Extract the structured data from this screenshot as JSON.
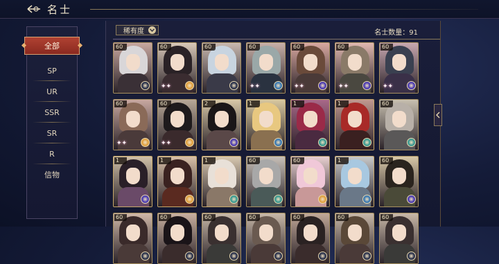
{
  "header": {
    "title": "名士"
  },
  "sidebar": {
    "items": [
      {
        "label": "全部",
        "active": true
      },
      {
        "label": "SP"
      },
      {
        "label": "UR"
      },
      {
        "label": "SSR"
      },
      {
        "label": "SR"
      },
      {
        "label": "R"
      },
      {
        "label": "信物"
      }
    ]
  },
  "toolbar": {
    "filter_label": "稀有度",
    "count_text": "名士数量：91"
  },
  "cards": [
    {
      "level": "60",
      "hair": "#d9d6d8",
      "bg": "#c8a8a0",
      "robe": "#3a3036",
      "badge": "#28304a",
      "sparkle": false
    },
    {
      "level": "60",
      "hair": "#2a2226",
      "bg": "#d8c8b8",
      "robe": "#3a2c30",
      "badge": "#e0a040",
      "sparkle": true
    },
    {
      "level": "60",
      "hair": "#c8d4e0",
      "bg": "#c8b8b0",
      "robe": "#3a3a48",
      "badge": "#28304a",
      "sparkle": false
    },
    {
      "level": "60",
      "hair": "#9aa8a8",
      "bg": "#c8b0a8",
      "robe": "#2a3240",
      "badge": "#3a78b0",
      "sparkle": true
    },
    {
      "level": "60",
      "hair": "#6a4a3a",
      "bg": "#d8a8a0",
      "robe": "#4a3a38",
      "badge": "#4a3ab0",
      "sparkle": true
    },
    {
      "level": "60",
      "hair": "#8a7a68",
      "bg": "#e0b8b0",
      "robe": "#4a4840",
      "badge": "#4a3ab0",
      "sparkle": true
    },
    {
      "level": "60",
      "hair": "#3a4050",
      "bg": "#c8a8b0",
      "robe": "#3a3048",
      "badge": "#4a3ab0",
      "sparkle": true
    },
    {
      "level": "60",
      "hair": "#8a6a58",
      "bg": "#c8a8a0",
      "robe": "#4a3a3a",
      "badge": "#e0a040",
      "sparkle": true
    },
    {
      "level": "60",
      "hair": "#1e1a1c",
      "bg": "#b8a898",
      "robe": "#3a2a2c",
      "badge": "#e0a040",
      "sparkle": true
    },
    {
      "level": "2",
      "hair": "#1a1618",
      "bg": "#d8c8a8",
      "robe": "#5a4848",
      "badge": "#4a3ab0",
      "sparkle": false
    },
    {
      "level": "1",
      "hair": "#e8c880",
      "bg": "#d8c8a0",
      "robe": "#8a7050",
      "badge": "#3a78b0",
      "sparkle": false
    },
    {
      "level": "1",
      "hair": "#9a2a48",
      "bg": "#a86888",
      "robe": "#4a2a40",
      "badge": "#3a9890",
      "sparkle": false
    },
    {
      "level": "1",
      "hair": "#a82a28",
      "bg": "#c09890",
      "robe": "#3a2020",
      "badge": "#3a9890",
      "sparkle": false
    },
    {
      "level": "60",
      "hair": "#b8b0a8",
      "bg": "#c8c0b0",
      "robe": "#5a5858",
      "badge": "#3a9890",
      "sparkle": false
    },
    {
      "level": "1",
      "hair": "#2a2028",
      "bg": "#d0c0a8",
      "robe": "#6a4a68",
      "badge": "#4a3ab0",
      "sparkle": false
    },
    {
      "level": "1",
      "hair": "#3a2220",
      "bg": "#d8c0a8",
      "robe": "#5a2a20",
      "badge": "#e0a040",
      "sparkle": false
    },
    {
      "level": "1",
      "hair": "#e8e0d8",
      "bg": "#d8c8b0",
      "robe": "#8a7868",
      "badge": "#3a9890",
      "sparkle": false
    },
    {
      "level": "60",
      "hair": "#a8a8a8",
      "bg": "#c8c0b8",
      "robe": "#4a5a58",
      "badge": "#3a9890",
      "sparkle": false
    },
    {
      "level": "60",
      "hair": "#f0c8d8",
      "bg": "#e8d0d0",
      "robe": "#c89898",
      "badge": "#e0a040",
      "sparkle": false
    },
    {
      "level": "1",
      "hair": "#a8c8e0",
      "bg": "#c8c8c8",
      "robe": "#6a7888",
      "badge": "#3a78b0",
      "sparkle": false
    },
    {
      "level": "60",
      "hair": "#2a241e",
      "bg": "#d8c8a8",
      "robe": "#4a4a38",
      "badge": "#4a3ab0",
      "sparkle": false
    },
    {
      "level": "60",
      "hair": "#3a2a2a",
      "bg": "#d0b8a8",
      "robe": "#4a3a38",
      "badge": "#28304a",
      "sparkle": false
    },
    {
      "level": "60",
      "hair": "#1a1418",
      "bg": "#c8b0a0",
      "robe": "#3a2c2c",
      "badge": "#28304a",
      "sparkle": false
    },
    {
      "level": "60",
      "hair": "#3a3030",
      "bg": "#c8b8a8",
      "robe": "#3a3a38",
      "badge": "#28304a",
      "sparkle": false
    },
    {
      "level": "60",
      "hair": "#6a5a50",
      "bg": "#c8b8a8",
      "robe": "#4a3a38",
      "badge": "#28304a",
      "sparkle": false
    },
    {
      "level": "60",
      "hair": "#2a2222",
      "bg": "#c0a898",
      "robe": "#3a2c2c",
      "badge": "#28304a",
      "sparkle": false
    },
    {
      "level": "60",
      "hair": "#5a4838",
      "bg": "#c8b8a8",
      "robe": "#4a3a38",
      "badge": "#28304a",
      "sparkle": false
    },
    {
      "level": "60",
      "hair": "#3a3030",
      "bg": "#c8b8a8",
      "robe": "#3a3a38",
      "badge": "#28304a",
      "sparkle": false
    }
  ]
}
